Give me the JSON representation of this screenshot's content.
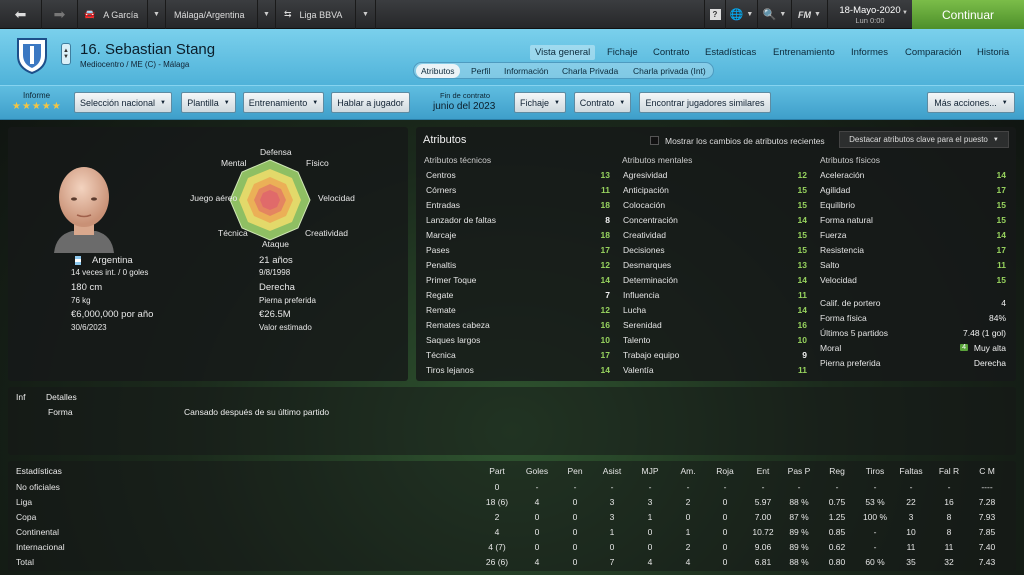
{
  "nav": {
    "manager": "A García",
    "club_comp": "Málaga/Argentina",
    "league": "Liga BBVA",
    "date": "18-Mayo-2020",
    "time": "Lun 0:00",
    "continue": "Continuar",
    "fm": "FM"
  },
  "player": {
    "name": "16. Sebastian Stang",
    "position_club": "Mediocentro / ME (C) - Málaga"
  },
  "tabs": [
    "Vista general",
    "Fichaje",
    "Contrato",
    "Estadísticas",
    "Entrenamiento",
    "Informes",
    "Comparación",
    "Historia"
  ],
  "subtabs": [
    "Atributos",
    "Perfil",
    "Información",
    "Charla Privada",
    "Charla privada (Int)"
  ],
  "toolbar": {
    "informe": "Informe",
    "stars": "★★★★★",
    "seleccion": "Selección nacional",
    "plantilla": "Plantilla",
    "entrenamiento": "Entrenamiento",
    "hablar": "Hablar a jugador",
    "fin_label": "Fin de contrato",
    "fin_value": "junio del 2023",
    "fichaje": "Fichaje",
    "contrato": "Contrato",
    "encontrar": "Encontrar jugadores similares",
    "mas": "Más acciones..."
  },
  "profile": {
    "nation": "Argentina",
    "caps": "14 veces int. / 0 goles",
    "height": "180 cm",
    "weight": "76 kg",
    "wage": "€6,000,000 por año",
    "expiry": "30/6/2023",
    "age": "21 años",
    "dob": "9/8/1998",
    "foot_value": "Derecha",
    "foot_label": "Pierna preferida",
    "value": "€26.5M",
    "value_label": "Valor estimado"
  },
  "radar": {
    "labels": [
      "Defensa",
      "Físico",
      "Velocidad",
      "Creatividad",
      "Ataque",
      "Técnica",
      "Juego aéreo",
      "Mental"
    ]
  },
  "attributes": {
    "title": "Atributos",
    "show_changes": "Mostrar los cambios de atributos recientes",
    "highlight": "Destacar atributos clave para el puesto",
    "tech_title": "Atributos técnicos",
    "mental_title": "Atributos mentales",
    "phys_title": "Atributos físicos",
    "technical": [
      [
        "Centros",
        "13"
      ],
      [
        "Córners",
        "11"
      ],
      [
        "Entradas",
        "18"
      ],
      [
        "Lanzador de faltas",
        "8"
      ],
      [
        "Marcaje",
        "18"
      ],
      [
        "Pases",
        "17"
      ],
      [
        "Penaltis",
        "12"
      ],
      [
        "Primer Toque",
        "14"
      ],
      [
        "Regate",
        "7"
      ],
      [
        "Remate",
        "12"
      ],
      [
        "Remates cabeza",
        "16"
      ],
      [
        "Saques largos",
        "10"
      ],
      [
        "Técnica",
        "17"
      ],
      [
        "Tiros lejanos",
        "14"
      ]
    ],
    "mental": [
      [
        "Agresividad",
        "12"
      ],
      [
        "Anticipación",
        "15"
      ],
      [
        "Colocación",
        "15"
      ],
      [
        "Concentración",
        "14"
      ],
      [
        "Creatividad",
        "15"
      ],
      [
        "Decisiones",
        "15"
      ],
      [
        "Desmarques",
        "13"
      ],
      [
        "Determinación",
        "14"
      ],
      [
        "Influencia",
        "11"
      ],
      [
        "Lucha",
        "14"
      ],
      [
        "Serenidad",
        "16"
      ],
      [
        "Talento",
        "10"
      ],
      [
        "Trabajo equipo",
        "9"
      ],
      [
        "Valentía",
        "11"
      ]
    ],
    "physical": [
      [
        "Aceleración",
        "14"
      ],
      [
        "Agilidad",
        "17"
      ],
      [
        "Equilibrio",
        "15"
      ],
      [
        "Forma natural",
        "15"
      ],
      [
        "Fuerza",
        "14"
      ],
      [
        "Resistencia",
        "17"
      ],
      [
        "Salto",
        "11"
      ],
      [
        "Velocidad",
        "15"
      ]
    ],
    "extra": [
      [
        "Calif. de portero",
        "4"
      ],
      [
        "Forma física",
        "84%"
      ],
      [
        "Últimos 5 partidos",
        "7.48 (1 gol)"
      ],
      [
        "Moral",
        "Muy alta"
      ],
      [
        "Pierna preferida",
        "Derecha"
      ]
    ],
    "moral_badge": "4"
  },
  "info": {
    "inf": "Inf",
    "detalles": "Detalles",
    "forma": "Forma",
    "forma_text": "Cansado después de su último partido"
  },
  "stats": {
    "title": "Estadísticas",
    "headers": [
      "Part",
      "Goles",
      "Pen",
      "Asist",
      "MJP",
      "Am.",
      "Roja",
      "Ent",
      "Pas P",
      "Reg",
      "Tiros",
      "Faltas",
      "Fal R",
      "C M"
    ],
    "rows": [
      [
        "No oficiales",
        "0",
        "-",
        "-",
        "-",
        "-",
        "-",
        "-",
        "-",
        "-",
        "-",
        "-",
        "-",
        "-",
        "----"
      ],
      [
        "Liga",
        "18 (6)",
        "4",
        "0",
        "3",
        "3",
        "2",
        "0",
        "5.97",
        "88 %",
        "0.75",
        "53 %",
        "22",
        "16",
        "7.28"
      ],
      [
        "Copa",
        "2",
        "0",
        "0",
        "3",
        "1",
        "0",
        "0",
        "7.00",
        "87 %",
        "1.25",
        "100 %",
        "3",
        "8",
        "7.93"
      ],
      [
        "Continental",
        "4",
        "0",
        "0",
        "1",
        "0",
        "1",
        "0",
        "10.72",
        "89 %",
        "0.85",
        "-",
        "10",
        "8",
        "7.85"
      ],
      [
        "Internacional",
        "4 (7)",
        "0",
        "0",
        "0",
        "0",
        "2",
        "0",
        "9.06",
        "89 %",
        "0.62",
        "-",
        "11",
        "11",
        "7.40"
      ],
      [
        "Total",
        "26 (6)",
        "4",
        "0",
        "7",
        "4",
        "4",
        "0",
        "6.81",
        "88 %",
        "0.80",
        "60 %",
        "35",
        "32",
        "7.43"
      ]
    ]
  }
}
